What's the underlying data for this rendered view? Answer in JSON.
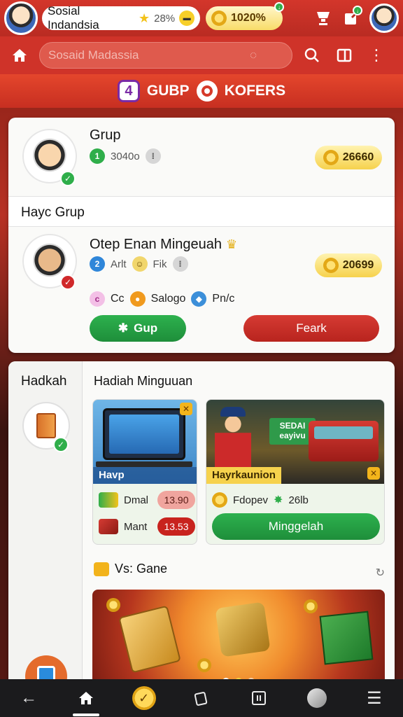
{
  "topbar": {
    "app_title": "Sosial Indandsia",
    "title_percent": "28%",
    "coins": "1020%"
  },
  "search": {
    "placeholder": "Sosaid Madassia"
  },
  "banner": {
    "badge": "4",
    "left_label": "GUBP",
    "right_label": "KOFERS"
  },
  "group": {
    "title": "Grup",
    "badge_num": "1",
    "count": "3040o",
    "coins": "26660"
  },
  "my_group": {
    "section_title": "Hayc Grup",
    "member_name": "Otep Enan Mingeuah",
    "badge_num": "2",
    "meta1": "Arlt",
    "meta2": "Fik",
    "coins": "20699",
    "tags": [
      "Cc",
      "Salogo",
      "Pn/c"
    ],
    "join_label": "Gup",
    "leave_label": "Feark"
  },
  "rewards": {
    "side_title": "Hadkah",
    "title": "Hadiah Minguuan",
    "tile1": {
      "caption": "Havp",
      "row1_label": "Dmal",
      "row1_value": "13.90",
      "row2_label": "Mant",
      "row2_value": "13.53"
    },
    "tile2": {
      "caption": "Hayrkaunion",
      "sign_text": "SEDAI eayivu",
      "row_label": "Fdopev",
      "row_value": "26lb",
      "button_label": "Minggelah"
    },
    "vs_title": "Vs: Gane"
  },
  "colors": {
    "primary_red": "#cf3329",
    "gold": "#f6d24d",
    "green": "#2db14e",
    "nav_bg": "#1b1b1d"
  }
}
